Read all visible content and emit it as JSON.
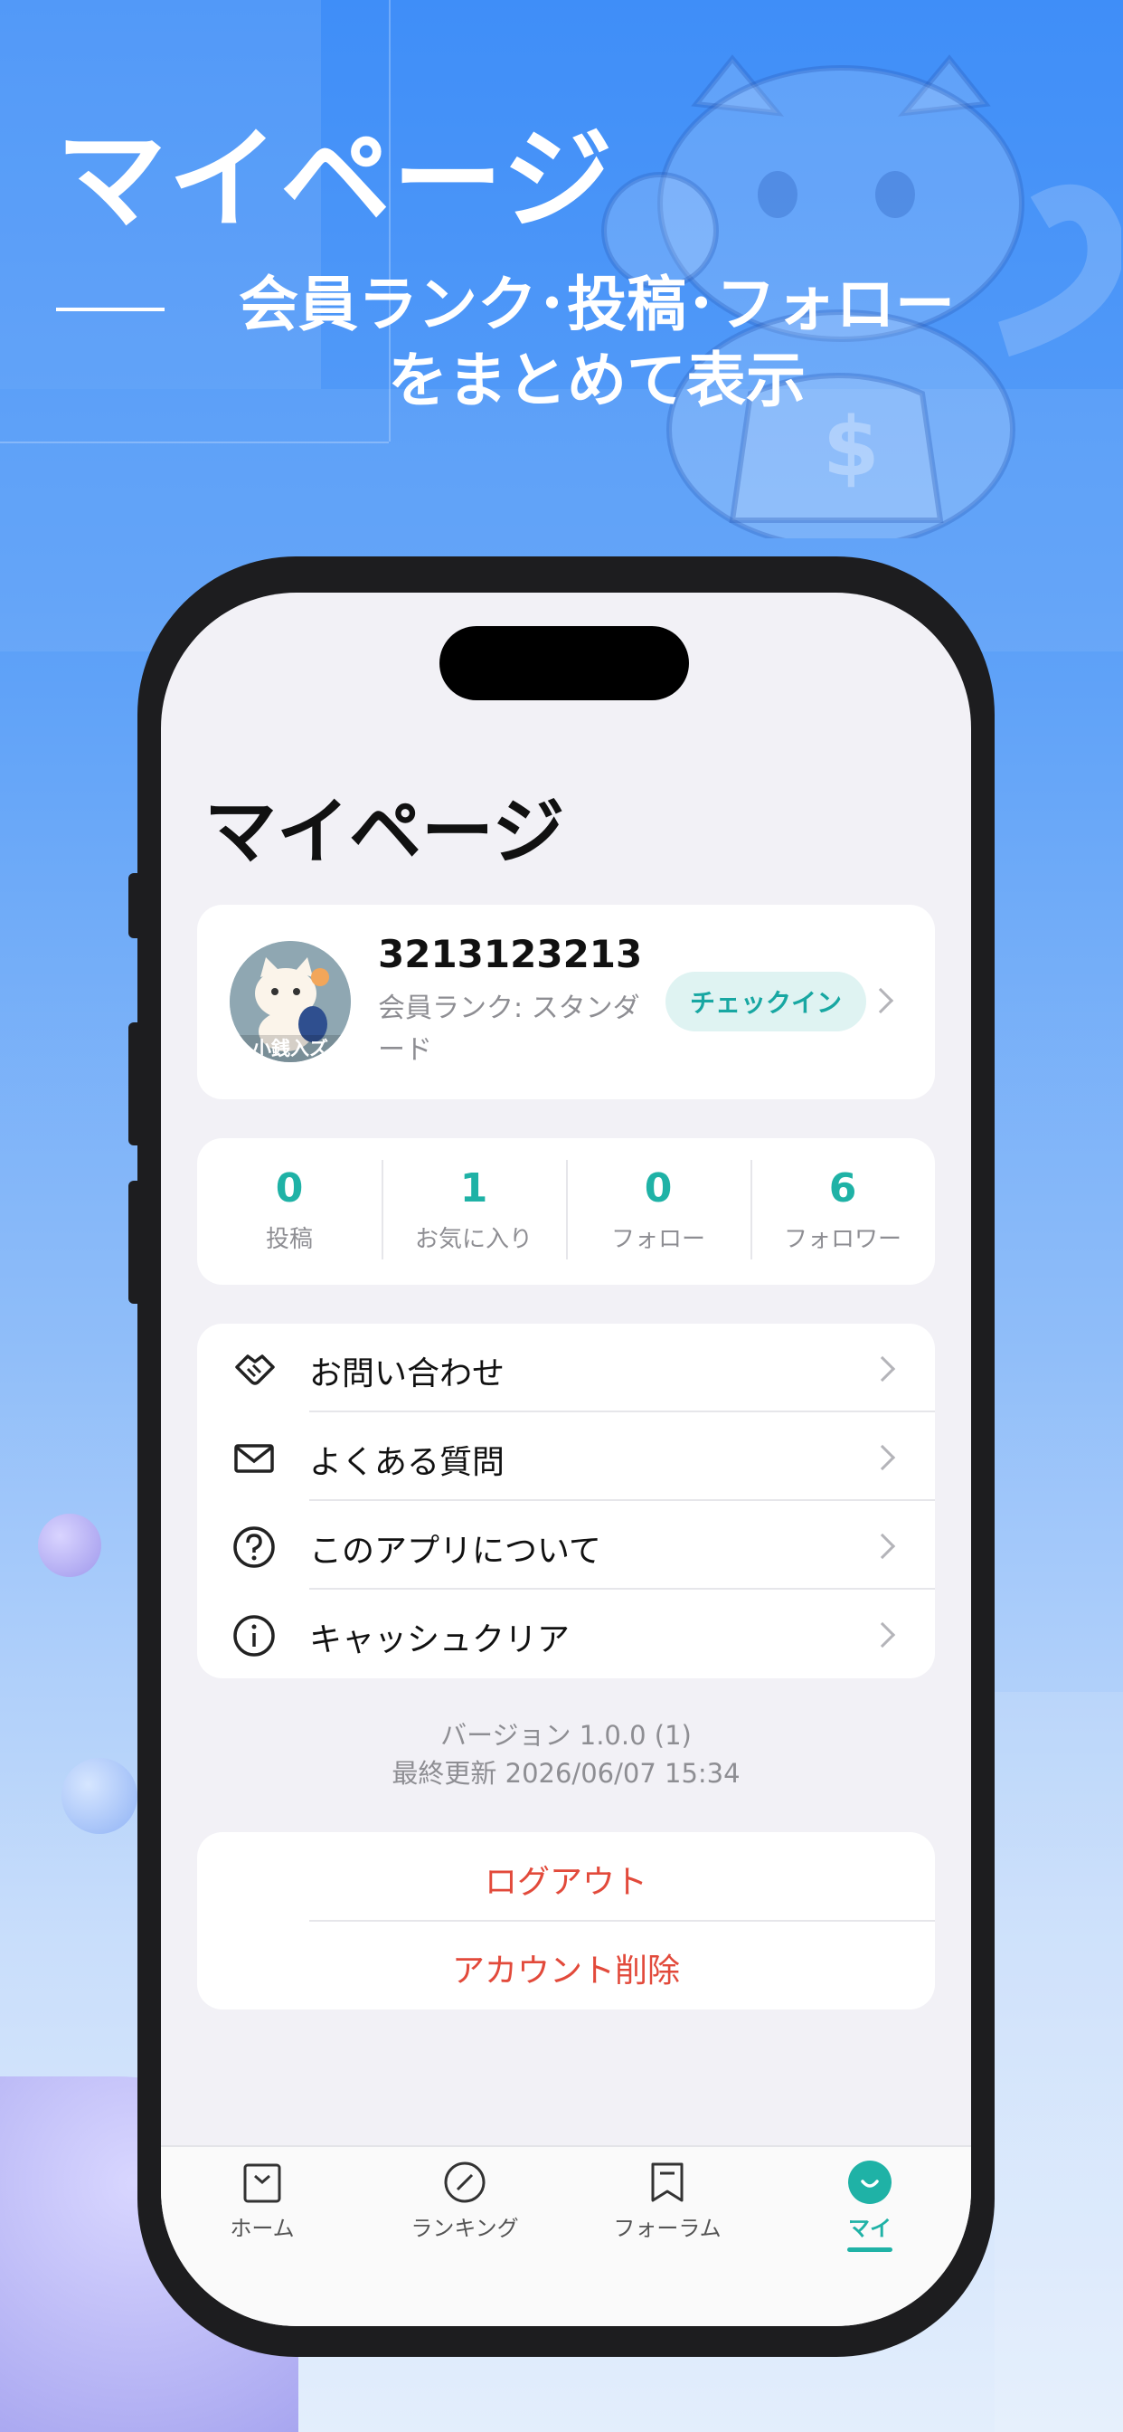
{
  "hero": {
    "title": "マイページ",
    "subtitle_line1": "会員ランク･投稿･フォロー",
    "subtitle_line2": "をまとめて表示"
  },
  "screen": {
    "page_title": "マイページ",
    "profile": {
      "username": "3213123213",
      "rank": "会員ランク: スタンダード",
      "checkin_label": "チェックイン",
      "avatar_text": "小銭入ズ"
    },
    "stats": [
      {
        "value": "0",
        "label": "投稿"
      },
      {
        "value": "1",
        "label": "お気に入り"
      },
      {
        "value": "0",
        "label": "フォロー"
      },
      {
        "value": "6",
        "label": "フォロワー"
      }
    ],
    "menu": [
      {
        "label": "お問い合わせ",
        "icon": "handshake-icon"
      },
      {
        "label": "よくある質問",
        "icon": "mail-icon"
      },
      {
        "label": "このアプリについて",
        "icon": "question-icon"
      },
      {
        "label": "キャッシュクリア",
        "icon": "info-icon"
      }
    ],
    "version": "バージョン 1.0.0 (1)",
    "last_updated": "最終更新 2026/06/07 15:34",
    "logout": "ログアウト",
    "delete_account": "アカウント削除",
    "tabs": [
      {
        "label": "ホーム",
        "icon": "home-icon"
      },
      {
        "label": "ランキング",
        "icon": "ranking-icon"
      },
      {
        "label": "フォーラム",
        "icon": "forum-icon"
      },
      {
        "label": "マイ",
        "icon": "my-icon",
        "active": true
      }
    ]
  },
  "colors": {
    "accent": "#1fb2a6",
    "danger": "#e24a3b",
    "background_top": "#3f8ef8"
  }
}
